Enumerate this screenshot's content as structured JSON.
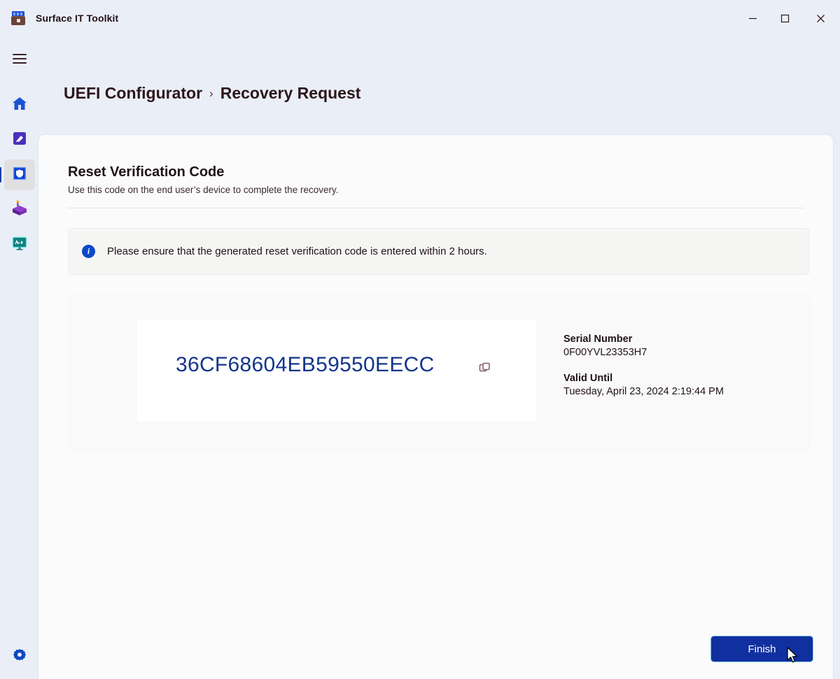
{
  "window": {
    "app_icon": "toolbox-icon",
    "title": "Surface IT Toolkit",
    "controls": {
      "minimize": "minimize-icon",
      "maximize": "maximize-icon",
      "close": "close-icon"
    }
  },
  "sidebar": {
    "menu_toggle": "hamburger-icon",
    "items": [
      {
        "name": "home",
        "icon": "home-icon",
        "selected": false
      },
      {
        "name": "data-eraser",
        "icon": "data-eraser-icon",
        "selected": false
      },
      {
        "name": "uefi-configurator",
        "icon": "shield-icon",
        "selected": true
      },
      {
        "name": "package-creator",
        "icon": "package-icon",
        "selected": false
      },
      {
        "name": "diagnostics",
        "icon": "monitor-icon",
        "selected": false
      }
    ],
    "settings": {
      "name": "settings",
      "icon": "gear-icon"
    }
  },
  "breadcrumb": {
    "parent": "UEFI Configurator",
    "separator": "›",
    "current": "Recovery Request"
  },
  "section": {
    "title": "Reset Verification Code",
    "subtitle": "Use this code on the end user’s device to complete the recovery."
  },
  "info_banner": {
    "icon": "info-icon",
    "message": "Please ensure that the generated reset verification code is entered within 2 hours."
  },
  "code_card": {
    "verification_code": "36CF68604EB59550EECC",
    "copy_icon": "copy-icon",
    "serial_number_label": "Serial Number",
    "serial_number_value": "0F00YVL23353H7",
    "valid_until_label": "Valid Until",
    "valid_until_value": "Tuesday, April 23, 2024 2:19:44 PM"
  },
  "footer": {
    "finish_label": "Finish"
  },
  "colors": {
    "page_background": "#eaeef7",
    "card_background": "#fafbfa",
    "accent_blue": "#10309f",
    "code_blue": "#12358c",
    "info_blue": "#0c49c8",
    "text_primary": "#201216"
  }
}
